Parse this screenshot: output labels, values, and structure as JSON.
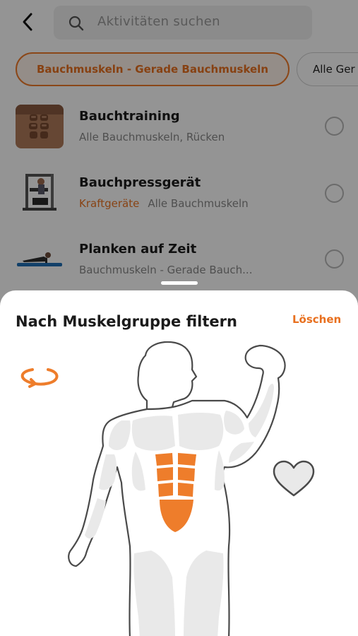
{
  "search": {
    "placeholder": "Aktivitäten suchen"
  },
  "filters": {
    "active_chip": "Bauchmuskeln - Gerade Bauchmuskeln",
    "other_chip": "Alle Ger"
  },
  "activities": [
    {
      "title": "Bauchtraining",
      "tag": "",
      "subtitle": "Alle Bauchmuskeln, Rücken"
    },
    {
      "title": "Bauchpressgerät",
      "tag": "Kraftgeräte",
      "subtitle": "Alle Bauchmuskeln"
    },
    {
      "title": "Planken auf Zeit",
      "tag": "",
      "subtitle": "Bauchmuskeln - Gerade Bauch..."
    }
  ],
  "sheet": {
    "title": "Nach Muskelgruppe filtern",
    "clear_label": "Löschen"
  },
  "colors": {
    "accent": "#ee7d2b",
    "muscle_inactive": "#e9e9e9",
    "outline": "#4a4a4a"
  },
  "icons": {
    "back": "chevron-left-icon",
    "search": "magnifier-icon",
    "rotate": "rotate-icon",
    "heart": "heart-icon"
  }
}
